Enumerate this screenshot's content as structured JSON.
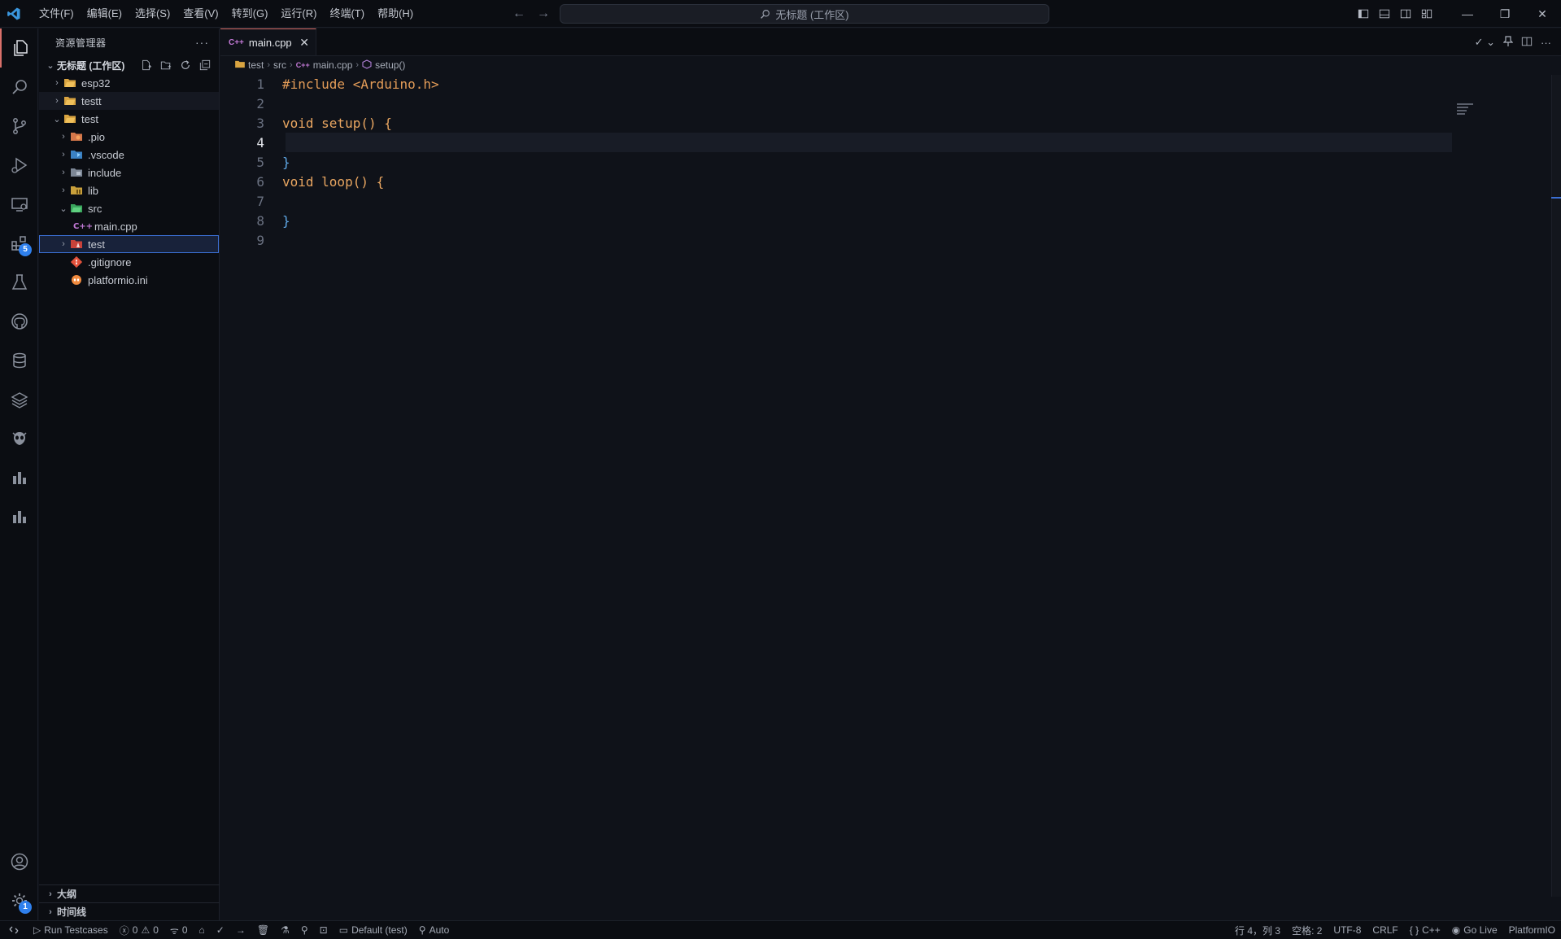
{
  "menu": [
    "文件(F)",
    "编辑(E)",
    "选择(S)",
    "查看(V)",
    "转到(G)",
    "运行(R)",
    "终端(T)",
    "帮助(H)"
  ],
  "command_center": "无标题 (工作区)",
  "activity": {
    "extensions_badge": "5",
    "settings_badge": "1"
  },
  "sidebar": {
    "title": "资源管理器",
    "more": "···",
    "workspace": "无标题 (工作区)",
    "items": [
      {
        "label": "esp32",
        "chev": "›",
        "icon": "folder-icon"
      },
      {
        "label": "testt",
        "chev": "›",
        "icon": "folder-icon"
      },
      {
        "label": "test",
        "chev": "⌄",
        "icon": "folder-open-icon"
      },
      {
        "label": ".pio",
        "chev": "›",
        "icon": "pio-folder-icon"
      },
      {
        "label": ".vscode",
        "chev": "›",
        "icon": "vscode-folder-icon"
      },
      {
        "label": "include",
        "chev": "›",
        "icon": "include-folder-icon"
      },
      {
        "label": "lib",
        "chev": "›",
        "icon": "lib-folder-icon"
      },
      {
        "label": "src",
        "chev": "⌄",
        "icon": "src-folder-icon"
      },
      {
        "label": "main.cpp",
        "chev": "",
        "icon": "cpp-file-icon"
      },
      {
        "label": "test",
        "chev": "›",
        "icon": "test-folder-icon"
      },
      {
        "label": ".gitignore",
        "chev": "",
        "icon": "git-icon"
      },
      {
        "label": "platformio.ini",
        "chev": "",
        "icon": "platformio-icon"
      }
    ],
    "outline": "大纲",
    "timeline": "时间线"
  },
  "tab": {
    "label": "main.cpp",
    "close": "✕"
  },
  "breadcrumb": [
    "test",
    "src",
    "main.cpp",
    "setup()"
  ],
  "code": [
    {
      "n": "1",
      "t": "#include <Arduino.h>"
    },
    {
      "n": "2",
      "t": ""
    },
    {
      "n": "3",
      "t": "void setup() {"
    },
    {
      "n": "4",
      "t": ""
    },
    {
      "n": "5",
      "t": "}"
    },
    {
      "n": "6",
      "t": "void loop() {"
    },
    {
      "n": "7",
      "t": ""
    },
    {
      "n": "8",
      "t": "}"
    },
    {
      "n": "9",
      "t": ""
    }
  ],
  "status": {
    "run_testcases": "Run Testcases",
    "errors": "0",
    "warnings": "0",
    "ports": "0",
    "env": "Default (test)",
    "auto": "Auto",
    "position": "行 4，列 3",
    "spaces": "空格: 2",
    "encoding": "UTF-8",
    "eol": "CRLF",
    "language": "C++",
    "golive": "Go Live",
    "platformio": "PlatformIO"
  },
  "colors": {
    "accent": "#d9706a",
    "selection": "#3b6fd4",
    "background": "#0f1219"
  }
}
